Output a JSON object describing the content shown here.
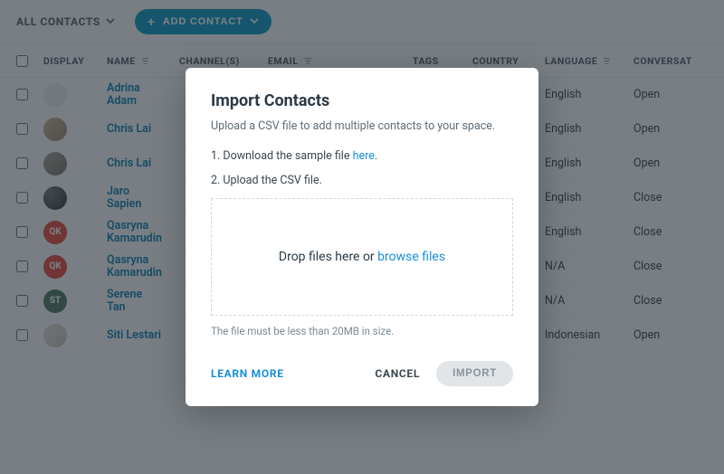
{
  "topbar": {
    "filter_label": "ALL CONTACTS",
    "add_label": "ADD CONTACT"
  },
  "table": {
    "headers": {
      "display": "DISPLAY",
      "name": "NAME",
      "channels": "CHANNEL(S)",
      "email": "EMAIL",
      "tags": "TAGS",
      "country": "COUNTRY",
      "language": "LANGUAGE",
      "conversation": "CONVERSAT"
    },
    "rows": [
      {
        "name_l1": "Adrina",
        "name_l2": "Adam",
        "avatar_class": "placeholder",
        "initials": "",
        "language": "English",
        "conversation": "Open"
      },
      {
        "name_l1": "Chris Lai",
        "name_l2": "",
        "avatar_class": "img1",
        "initials": "",
        "language": "English",
        "conversation": "Open"
      },
      {
        "name_l1": "Chris Lai",
        "name_l2": "",
        "avatar_class": "img2",
        "initials": "",
        "language": "English",
        "conversation": "Open"
      },
      {
        "name_l1": "Jaro",
        "name_l2": "Sapien",
        "avatar_class": "grad1",
        "initials": "",
        "language": "English",
        "conversation": "Close"
      },
      {
        "name_l1": "Qasryna",
        "name_l2": "Kamarudin",
        "avatar_class": "red",
        "initials": "QK",
        "language": "English",
        "conversation": "Close"
      },
      {
        "name_l1": "Qasryna",
        "name_l2": "Kamarudin",
        "avatar_class": "red",
        "initials": "QK",
        "language": "N/A",
        "conversation": "Close"
      },
      {
        "name_l1": "Serene",
        "name_l2": "Tan",
        "avatar_class": "green",
        "initials": "ST",
        "language": "N/A",
        "conversation": "Close"
      },
      {
        "name_l1": "Siti Lestari",
        "name_l2": "",
        "avatar_class": "pale",
        "initials": "",
        "language": "Indonesian",
        "conversation": "Open"
      }
    ]
  },
  "modal": {
    "title": "Import Contacts",
    "subtitle": "Upload a CSV file to add multiple contacts to your space.",
    "step1_pre": "1. Download the sample file ",
    "step1_link": "here",
    "step1_post": ".",
    "step2": "2. Upload the CSV file.",
    "drop_pre": "Drop files here or ",
    "drop_link": "browse files",
    "note": "The file must be less than 20MB in size.",
    "learn": "LEARN MORE",
    "cancel": "CANCEL",
    "import": "IMPORT"
  }
}
